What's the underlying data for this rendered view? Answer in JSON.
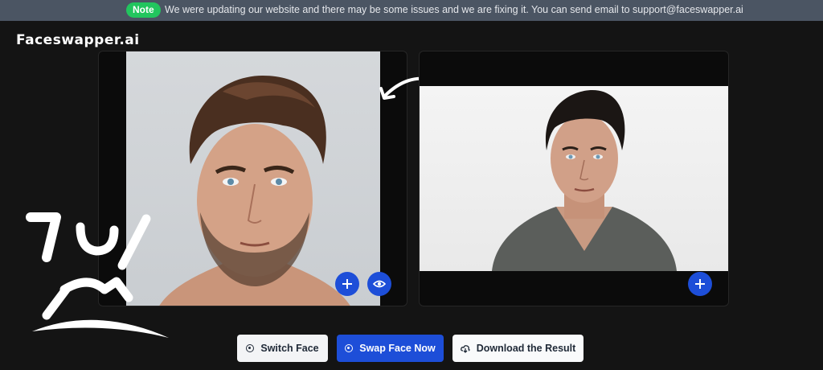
{
  "banner": {
    "badge": "Note",
    "message": "We were updating our website and there may be some issues and we are fixing it. You can send email to support@faceswapper.ai"
  },
  "logo": {
    "text": "Faceswapper.ai"
  },
  "panels": {
    "left": {
      "add_icon": "plus-icon",
      "preview_icon": "eye-icon"
    },
    "right": {
      "add_icon": "plus-icon"
    }
  },
  "actions": {
    "switch_label": "Switch Face",
    "swap_label": "Swap Face Now",
    "download_label": "Download the Result"
  },
  "colors": {
    "banner_bg": "#4b5563",
    "badge_green": "#22c55e",
    "accent_blue": "#1d4ed8",
    "page_bg": "#141414"
  }
}
